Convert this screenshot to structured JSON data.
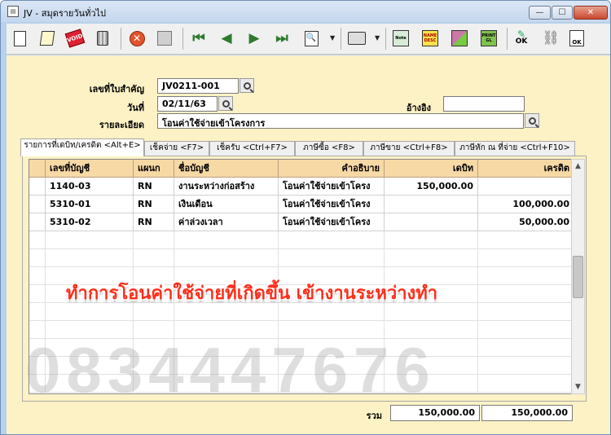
{
  "window": {
    "title": "JV - สมุดรายวันทั่วไป",
    "icon": "document-icon",
    "min": "—",
    "max": "☐",
    "close": "✕"
  },
  "toolbar": {
    "void_label": "VOID",
    "note_label": "Note",
    "desc_label": "NAME DESC",
    "gl_label": "PRINT GL",
    "ok_label": "OK",
    "ok2_label": "OK",
    "icons": [
      "new-document-icon",
      "edit-icon",
      "void-icon",
      "trash-icon",
      "cancel-icon",
      "save-icon",
      "first-record-icon",
      "previous-record-icon",
      "next-record-icon",
      "last-record-icon",
      "search-document-icon",
      "print-icon",
      "note-icon",
      "name-desc-icon",
      "mixed-icon",
      "print-gl-icon",
      "approve-ok-icon",
      "link-icon",
      "document-ok-icon"
    ]
  },
  "form": {
    "doc_no_label": "เลขที่ใบสำคัญ",
    "doc_no": "JV0211-001",
    "date_label": "วันที่",
    "date": "02/11/63",
    "ref_label": "อ้างอิง",
    "ref": "",
    "detail_label": "รายละเอียด",
    "detail": "โอนค่าใช้จ่ายเข้าโครงการ"
  },
  "tabs": [
    "รายการที่เดบิท/เครดิต <Alt+E>",
    "เช็คจ่าย <F7>",
    "เช็ครับ <Ctrl+F7>",
    "ภาษีซื้อ <F8>",
    "ภาษีขาย <Ctrl+F8>",
    "ภาษีหัก ณ ที่จ่าย <Ctrl+F10>"
  ],
  "grid": {
    "columns": [
      "เลขที่บัญชี",
      "แผนก",
      "ชื่อบัญชี",
      "คำอธิบาย",
      "เดบิท",
      "เครดิต"
    ],
    "rows": [
      [
        "1140-03",
        "RN",
        "งานระหว่างก่อสร้าง",
        "โอนค่าใช้จ่ายเข้าโครง",
        "150,000.00",
        ""
      ],
      [
        "5310-01",
        "RN",
        "เงินเดือน",
        "โอนค่าใช้จ่ายเข้าโครง",
        "",
        "100,000.00"
      ],
      [
        "5310-02",
        "RN",
        "ค่าล่วงเวลา",
        "โอนค่าใช้จ่ายเข้าโครง",
        "",
        "50,000.00"
      ]
    ]
  },
  "overlay_caption": "ทำการโอนค่าใช้จ่ายที่เกิดขึ้น เข้างานระหว่างทำ",
  "watermark": "0834447676",
  "totals": {
    "label": "รวม",
    "debit": "150,000.00",
    "credit": "150,000.00"
  },
  "colors": {
    "form_bg": "#fcf2c5",
    "header_bg": "#f7d9a6",
    "window_frame": "#b9d1ea",
    "caption": "#ff2e1a"
  }
}
